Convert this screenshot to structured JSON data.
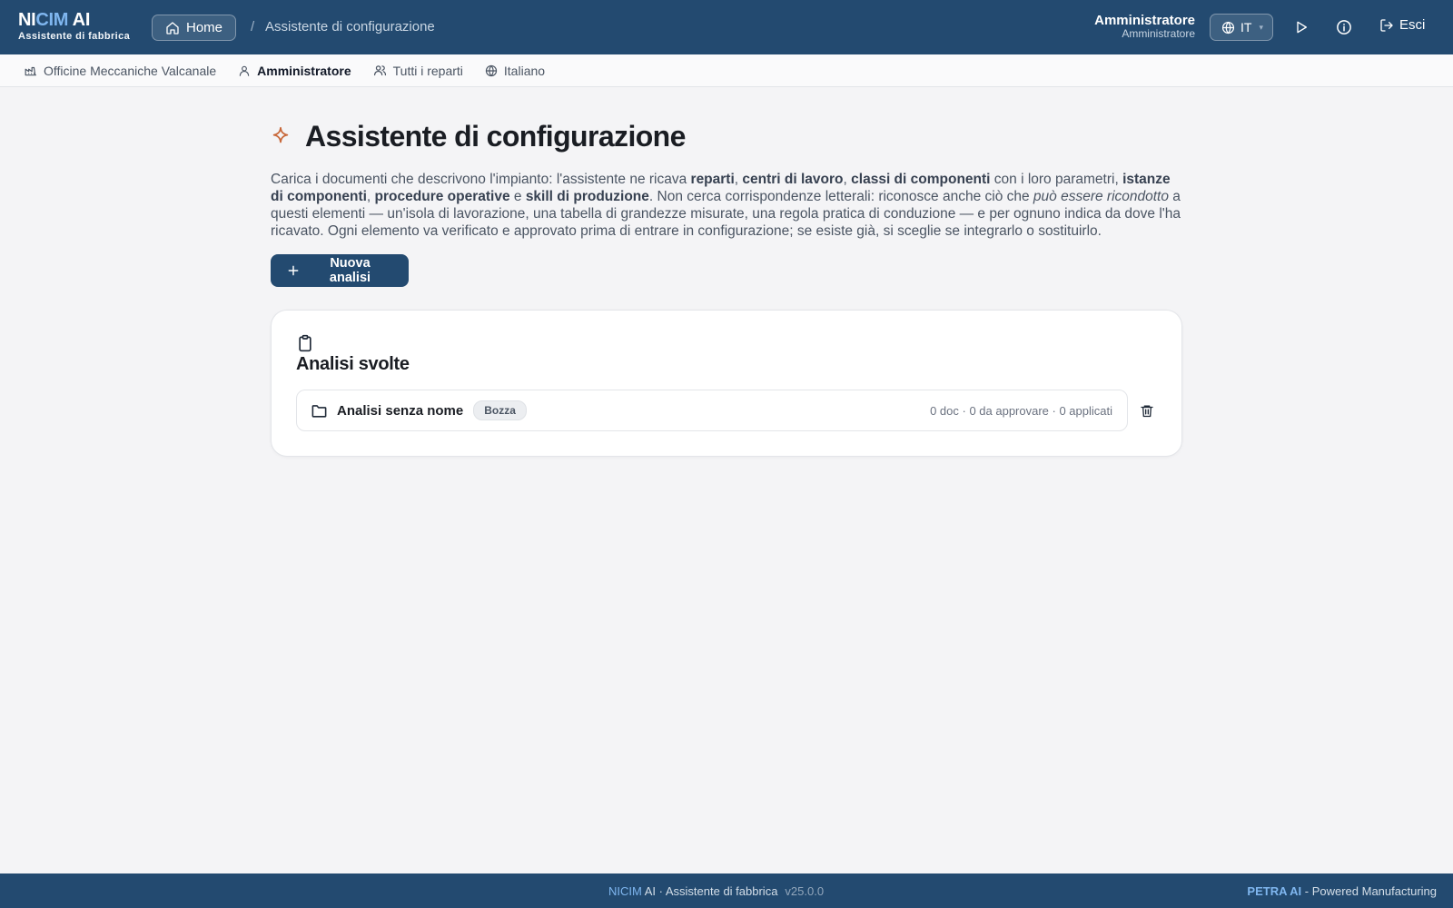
{
  "brand": {
    "name_part1": "NI",
    "name_part2": "CIM",
    "name_part3": " AI",
    "subtitle": "Assistente di fabbrica"
  },
  "topbar": {
    "home_label": "Home",
    "breadcrumb_separator": "/",
    "breadcrumb_current": "Assistente di configurazione",
    "user_name": "Amministratore",
    "user_role": "Amministratore",
    "language_code": "IT",
    "logout_label": "Esci"
  },
  "subbar": {
    "plant": "Officine Meccaniche Valcanale",
    "role": "Amministratore",
    "departments": "Tutti i reparti",
    "language": "Italiano"
  },
  "main": {
    "title": "Assistente di configurazione",
    "desc": {
      "t1": "Carica i documenti che descrivono l'impianto: l'assistente ne ricava ",
      "b1": "reparti",
      "t2": ", ",
      "b2": "centri di lavoro",
      "t3": ", ",
      "b3": "classi di componenti",
      "t4": " con i loro parametri, ",
      "b4": "istanze di componenti",
      "t5": ", ",
      "b5": "procedure operative",
      "t6": " e ",
      "b6": "skill di produzione",
      "t7": ". Non cerca corrispondenze letterali: riconosce anche ciò che ",
      "i1": "può essere ricondotto",
      "t8": " a questi elementi — un'isola di lavorazione, una tabella di grandezze misurate, una regola pratica di conduzione — e per ognuno indica da dove l'ha ricavato. Ogni elemento va verificato e approvato prima di entrare in configurazione; se esiste già, si sceglie se integrarlo o sostituirlo."
    },
    "new_button_label": "Nuova analisi",
    "card": {
      "title": "Analisi svolte",
      "rows": [
        {
          "name": "Analisi senza nome",
          "status": "Bozza",
          "stats": "0 doc · 0 da approvare · 0 applicati"
        }
      ]
    }
  },
  "footer": {
    "brand_part1": "NI",
    "brand_part2": "CIM",
    "brand_rest": " AI · Assistente di fabbrica",
    "version": "v25.0.0",
    "petra": "PETRA AI",
    "powered": " - Powered Manufacturing"
  },
  "colors": {
    "primary": "#234a70",
    "accent_light_blue": "#7fb6ef",
    "sparkle": "#c8683a",
    "background": "#f4f4f6"
  },
  "icons": {
    "home": "home-icon",
    "globe": "globe-icon",
    "play": "play-icon",
    "info": "info-icon",
    "logout": "logout-icon",
    "factory": "factory-icon",
    "user": "user-icon",
    "users": "users-icon",
    "sparkle": "sparkle-icon",
    "plus": "plus-icon",
    "clipboard": "clipboard-icon",
    "folder": "folder-icon",
    "trash": "trash-icon"
  }
}
